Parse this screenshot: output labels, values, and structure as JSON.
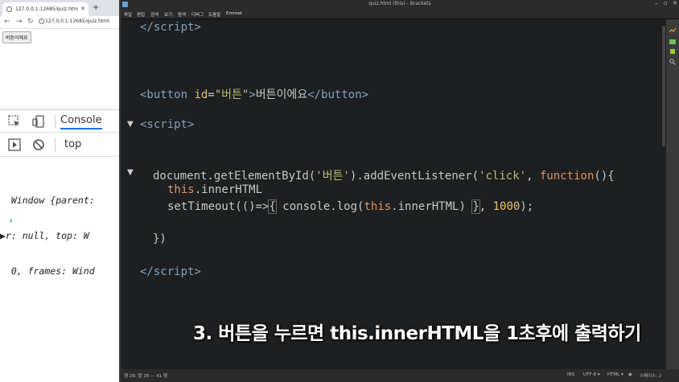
{
  "browser": {
    "tab_title": "127.0.0.1:12685/quiz.htm",
    "new_tab": "+",
    "url": "127.0.0.1:12685/quiz.html",
    "page_button_label": "버튼이에요",
    "devtools": {
      "console_tab": "Console",
      "context": "top",
      "output": [
        "  Window {parent:",
        "▶r: null, top: W",
        "  0, frames: Wind"
      ]
    }
  },
  "editor": {
    "window_title": "quiz.html (this) - Brackets",
    "menu": [
      "파일",
      "편집",
      "검색",
      "보기",
      "탐색",
      "디버그",
      "도움말",
      "Emmet"
    ],
    "status": {
      "position": "행 29, 열 28 — 41 행",
      "ins": "INS",
      "encoding": "UTF-8 ▾",
      "language": "HTML ▾",
      "spaces": "스페이스: 2"
    }
  },
  "caption": "3. 버튼을 누르면 this.innerHTML을 1초후에 출력하기",
  "colors": {
    "editor_bg": "#1d1f21",
    "tag": "#81a2be",
    "string": "#b5bd68",
    "keyword": "#de935f",
    "number": "#e6c06a"
  }
}
